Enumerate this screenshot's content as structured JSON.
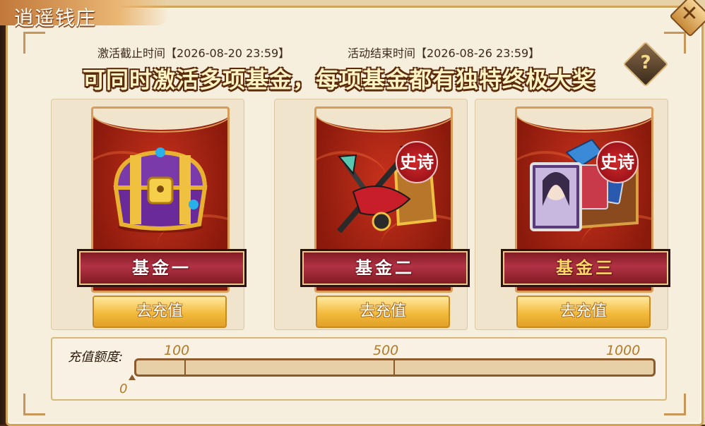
{
  "window": {
    "title": "逍遥钱庄",
    "close_symbol": "✕"
  },
  "info": {
    "activate_deadline": "激活截止时间【2026-08-20 23:59】",
    "event_end": "活动结束时间【2026-08-26 23:59】"
  },
  "headline": "可同时激活多项基金，每项基金都有独特终极大奖",
  "help_symbol": "?",
  "funds": [
    {
      "name": "基金一",
      "button": "去充值",
      "icon": "treasure-chest-icon"
    },
    {
      "name": "基金二",
      "button": "去充值",
      "icon": "weapon-bundle-icon",
      "badge": "史诗"
    },
    {
      "name": "基金三",
      "button": "去充值",
      "icon": "hero-card-chest-icon",
      "badge": "史诗"
    }
  ],
  "progress": {
    "label": "充值额度:",
    "current": "0",
    "milestones": [
      "100",
      "500",
      "1000"
    ],
    "value": 0
  },
  "colors": {
    "accent_gold": "#f2bb3c",
    "card_red": "#8a1a0c",
    "label_red": "#b23245"
  }
}
